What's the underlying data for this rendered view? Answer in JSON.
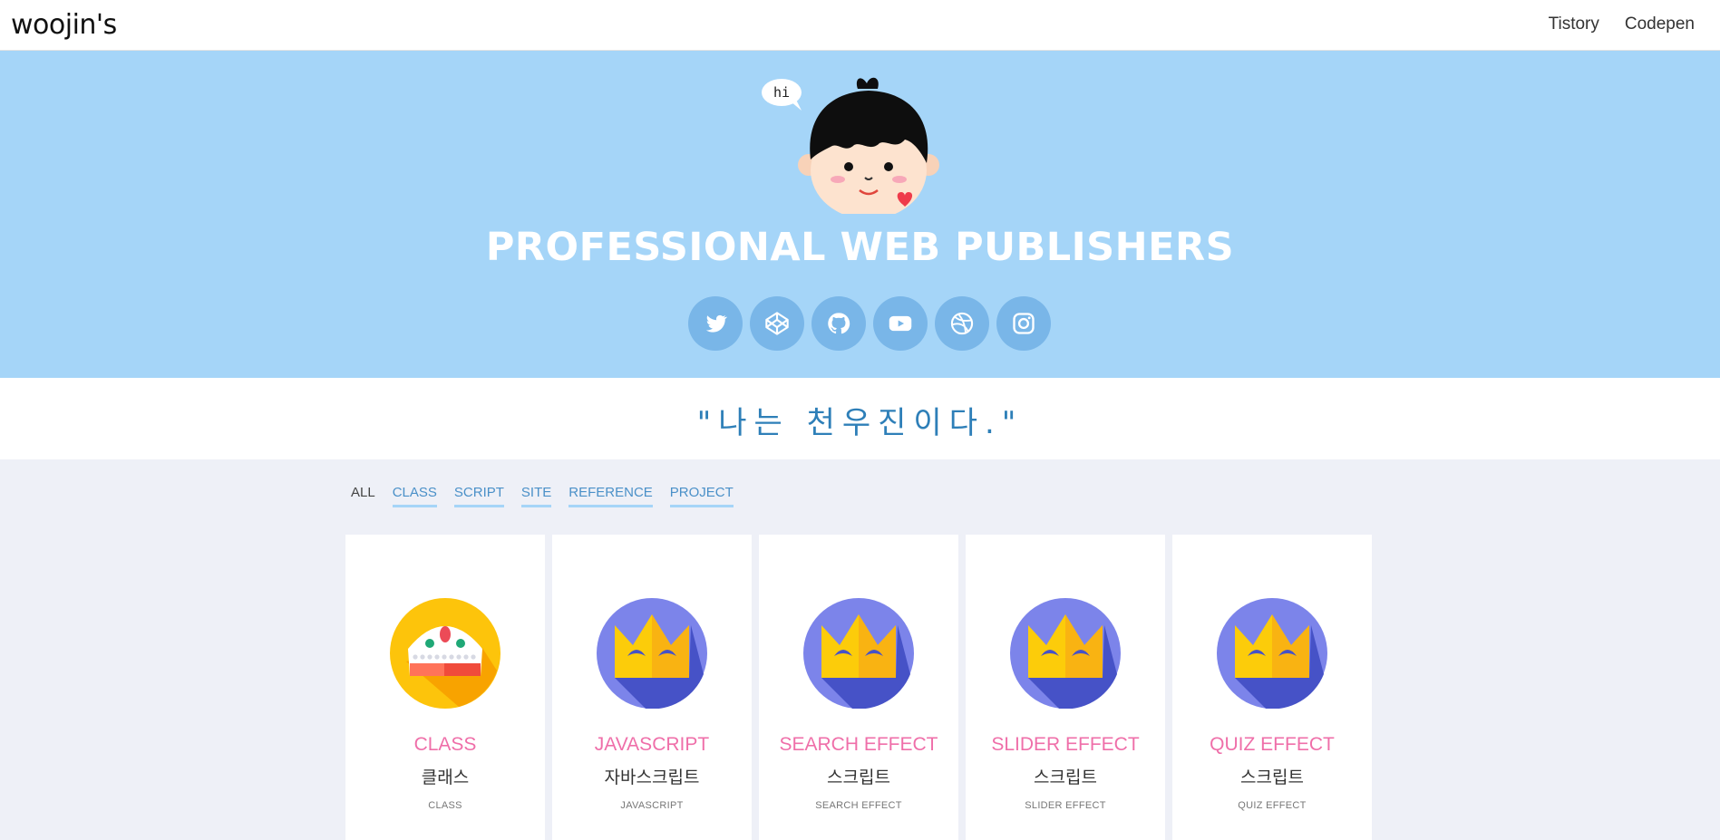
{
  "header": {
    "logo": "woojin's",
    "nav": [
      {
        "label": "Tistory"
      },
      {
        "label": "Codepen"
      }
    ]
  },
  "hero": {
    "speech": "hi",
    "title": "PROFESSIONAL WEB PUBLISHERS",
    "socials": [
      {
        "name": "twitter-icon"
      },
      {
        "name": "codepen-icon"
      },
      {
        "name": "github-icon"
      },
      {
        "name": "youtube-icon"
      },
      {
        "name": "dribbble-icon"
      },
      {
        "name": "instagram-icon"
      }
    ],
    "colors": {
      "background": "#a5d5f8",
      "social_bg": "#79b6e8"
    }
  },
  "quote": "\"나는 천우진이다.\"",
  "filters": [
    {
      "label": "ALL",
      "active": true
    },
    {
      "label": "CLASS"
    },
    {
      "label": "SCRIPT"
    },
    {
      "label": "SITE"
    },
    {
      "label": "REFERENCE"
    },
    {
      "label": "PROJECT"
    }
  ],
  "cards": [
    {
      "icon": "crown-icon",
      "title": "CLASS",
      "subtitle": "클래스",
      "small": "CLASS"
    },
    {
      "icon": "crown-icon",
      "title": "JAVASCRIPT",
      "subtitle": "자바스크립트",
      "small": "JAVASCRIPT"
    },
    {
      "icon": "crown-icon",
      "title": "SEARCH EFFECT",
      "subtitle": "스크립트",
      "small": "SEARCH EFFECT"
    },
    {
      "icon": "crown-icon",
      "title": "SLIDER EFFECT",
      "subtitle": "스크립트",
      "small": "SLIDER EFFECT"
    },
    {
      "icon": "crown-icon",
      "title": "QUIZ EFFECT",
      "subtitle": "스크립트",
      "small": "QUIZ EFFECT"
    }
  ]
}
